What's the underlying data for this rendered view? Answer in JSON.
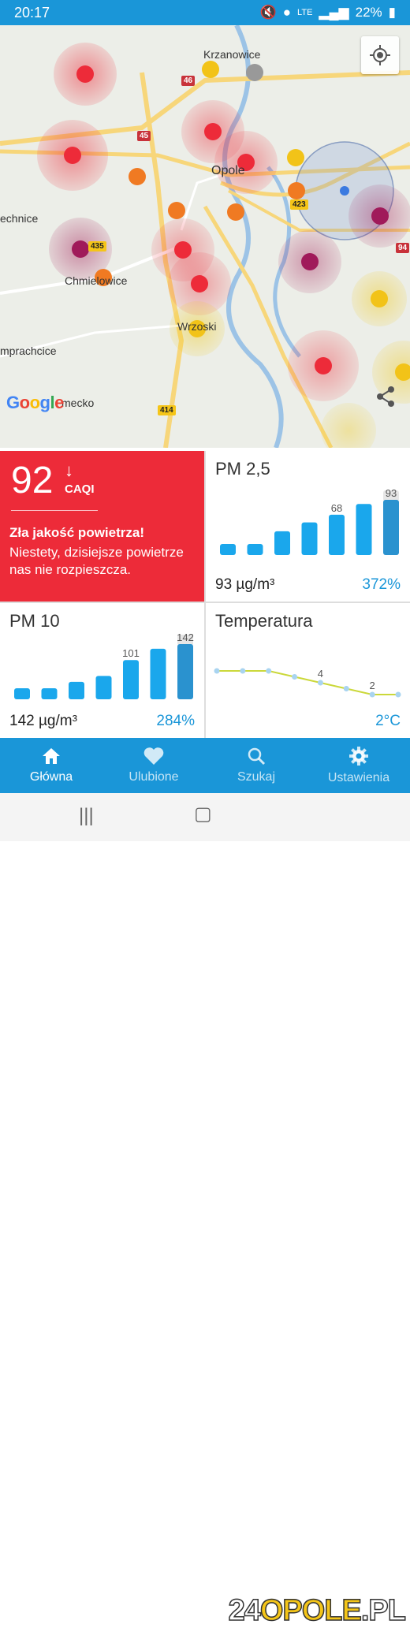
{
  "status_bar": {
    "time": "20:17",
    "network": "LTE",
    "battery": "22%"
  },
  "map": {
    "labels": {
      "krzanowice": "Krzanowice",
      "opole": "Opole",
      "technice": "echnice",
      "chmielowice": "Chmielowice",
      "wrzoski": "Wrzoski",
      "prachcice": "mprachcice",
      "domecko": "mecko"
    },
    "roads": [
      "46",
      "45",
      "423",
      "435",
      "414",
      "94"
    ],
    "google": "Google",
    "icons": {
      "locate": "crosshair-icon",
      "share": "share-icon"
    }
  },
  "caqi": {
    "value": "92",
    "arrow": "↓",
    "unit": "CAQI",
    "headline": "Zła jakość powietrza!",
    "description": "Niestety, dzisiejsze powietrze nas nie rozpieszcza.",
    "color": "#ed2b39"
  },
  "pm25": {
    "title": "PM 2,5",
    "value": "93 µg/m³",
    "percent": "372%",
    "bars": [
      18,
      18,
      40,
      55,
      68,
      86,
      93
    ],
    "labels": {
      "4": "68",
      "6": "93"
    }
  },
  "pm10": {
    "title": "PM 10",
    "value": "142 µg/m³",
    "percent": "284%",
    "bars": [
      20,
      20,
      45,
      60,
      101,
      130,
      142
    ],
    "labels": {
      "4": "101",
      "6": "142"
    }
  },
  "temperature": {
    "title": "Temperatura",
    "value": "2°C",
    "points": [
      6,
      6,
      6,
      5,
      4,
      3,
      2,
      2
    ],
    "labels": {
      "4": "4",
      "6": "2"
    }
  },
  "bottom_nav": [
    {
      "label": "Główna",
      "icon": "home-icon",
      "active": true
    },
    {
      "label": "Ulubione",
      "icon": "heart-icon",
      "active": false
    },
    {
      "label": "Szukaj",
      "icon": "search-icon",
      "active": false
    },
    {
      "label": "Ustawienia",
      "icon": "gear-icon",
      "active": false
    }
  ],
  "watermark": "24OPOLE.PL",
  "colors": {
    "accent": "#1a96d8",
    "bad": "#ed2b39",
    "bar": "#1aa7ec",
    "bar_current": "#2a92cf",
    "line": "#cbd83a"
  }
}
